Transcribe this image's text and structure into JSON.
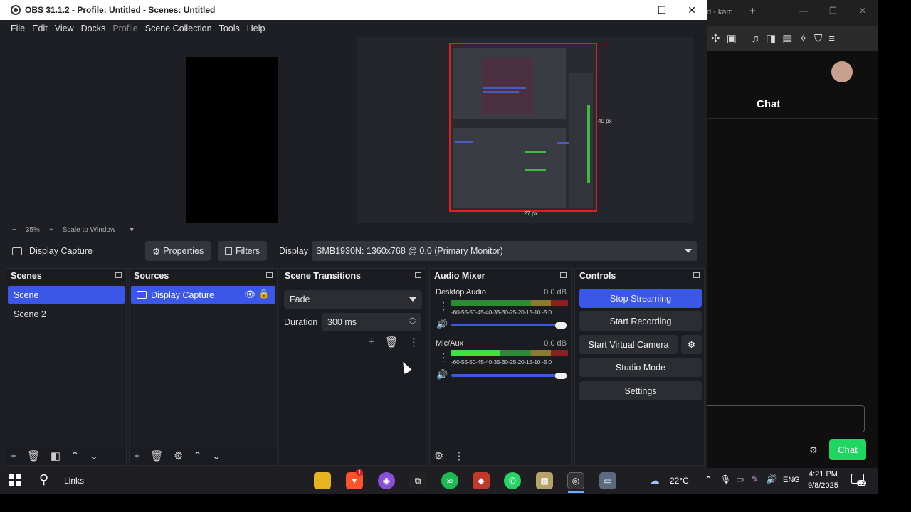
{
  "obs": {
    "window_title": "OBS 31.1.2 - Profile: Untitled - Scenes: Untitled",
    "menu": [
      "File",
      "Edit",
      "View",
      "Docks",
      "Profile",
      "Scene Collection",
      "Tools",
      "Help"
    ],
    "preview": {
      "zoom_minus": "−",
      "zoom_level": "35%",
      "zoom_plus": "+",
      "scale_mode": "Scale to Window",
      "capture_size_label_right": "40 px",
      "capture_size_label_bottom": "27 px"
    },
    "source_bar": {
      "source_name": "Display Capture",
      "properties_label": "Properties",
      "filters_label": "Filters",
      "display_label": "Display",
      "display_value": "SMB1930N: 1360x768 @ 0,0 (Primary Monitor)"
    },
    "scenes": {
      "title": "Scenes",
      "items": [
        "Scene",
        "Scene 2"
      ],
      "selected": "Scene"
    },
    "sources": {
      "title": "Sources",
      "items": [
        "Display Capture"
      ]
    },
    "transitions": {
      "title": "Scene Transitions",
      "transition": "Fade",
      "duration_label": "Duration",
      "duration_value": "300 ms"
    },
    "mixer": {
      "title": "Audio Mixer",
      "channels": [
        {
          "name": "Desktop Audio",
          "db": "0.0 dB",
          "level": 0.0
        },
        {
          "name": "Mic/Aux",
          "db": "0.0 dB",
          "level": 0.42
        }
      ],
      "ticks": "-60-55-50-45-40-35-30-25-20-15-10 -5  0"
    },
    "controls": {
      "title": "Controls",
      "stop_streaming": "Stop Streaming",
      "start_recording": "Start Recording",
      "start_virtual_camera": "Start Virtual Camera",
      "studio_mode": "Studio Mode",
      "settings": "Settings"
    }
  },
  "browser": {
    "tab_fragment": "d - kam",
    "chat_title": "Chat",
    "chat_button": "Chat"
  },
  "taskbar": {
    "links_label": "Links",
    "weather": "22°C",
    "language": "ENG",
    "time": "4:21 PM",
    "date": "9/8/2025",
    "notification_count": "12",
    "brave_badge": "1"
  },
  "colors": {
    "accent": "#3a57e8",
    "chat_button": "#1ed760",
    "capture_border": "#e02020"
  }
}
